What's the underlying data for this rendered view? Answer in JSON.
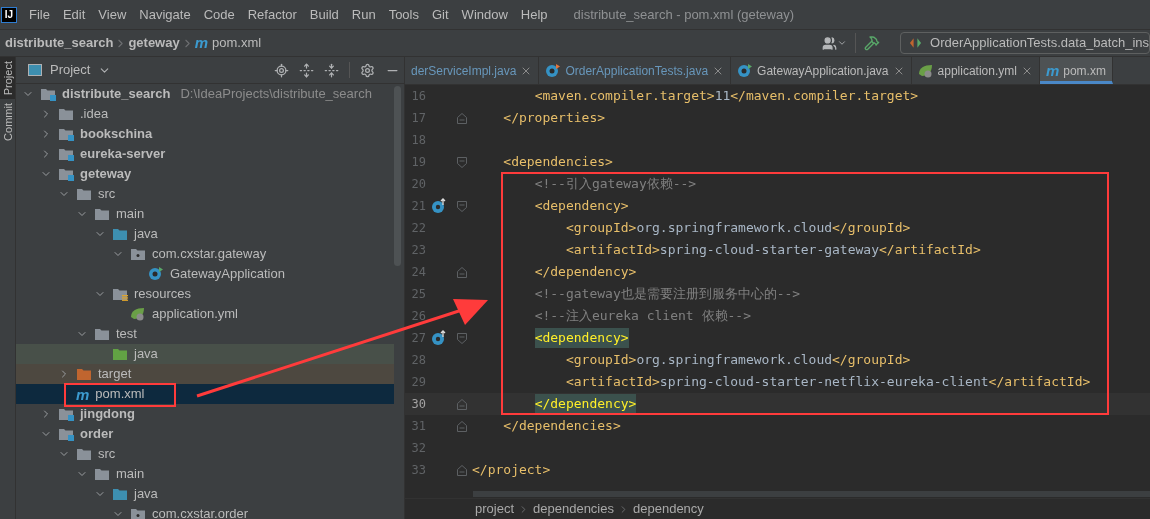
{
  "logo": "IJ",
  "menu": [
    "File",
    "Edit",
    "View",
    "Navigate",
    "Code",
    "Refactor",
    "Build",
    "Run",
    "Tools",
    "Git",
    "Window",
    "Help"
  ],
  "window_title": "distribute_search - pom.xml (geteway)",
  "navbar": {
    "crumbs": [
      {
        "label": "distribute_search"
      },
      {
        "label": "geteway"
      },
      {
        "label": "pom.xml",
        "badge": "m"
      }
    ],
    "run_config": "OrderApplicationTests.data_batch_ins"
  },
  "tool_strip": [
    {
      "label": "Project",
      "selected": true
    },
    {
      "label": "Commit",
      "selected": false
    }
  ],
  "project_panel": {
    "title": "Project",
    "tree": [
      {
        "label": "distribute_search",
        "kind": "module",
        "path": "D:\\IdeaProjects\\distribute_search",
        "expanded": true,
        "selected": false,
        "children": [
          {
            "label": ".idea",
            "kind": "folder",
            "expanded": false,
            "selected": false
          },
          {
            "label": "bookschina",
            "kind": "module",
            "expanded": false,
            "selected": false
          },
          {
            "label": "eureka-server",
            "kind": "module",
            "expanded": false,
            "selected": false
          },
          {
            "label": "geteway",
            "kind": "module",
            "expanded": true,
            "selected": false,
            "children": [
              {
                "label": "src",
                "kind": "folder",
                "expanded": true,
                "selected": false,
                "children": [
                  {
                    "label": "main",
                    "kind": "folder",
                    "expanded": true,
                    "selected": false,
                    "children": [
                      {
                        "label": "java",
                        "kind": "source",
                        "expanded": true,
                        "selected": false,
                        "children": [
                          {
                            "label": "com.cxstar.gateway",
                            "kind": "package",
                            "expanded": true,
                            "selected": false,
                            "children": [
                              {
                                "label": "GatewayApplication",
                                "kind": "class",
                                "selected": false
                              }
                            ]
                          }
                        ]
                      },
                      {
                        "label": "resources",
                        "kind": "resources",
                        "expanded": true,
                        "selected": false,
                        "children": [
                          {
                            "label": "application.yml",
                            "kind": "yml",
                            "selected": false
                          }
                        ]
                      }
                    ]
                  },
                  {
                    "label": "test",
                    "kind": "folder",
                    "expanded": true,
                    "selected": false,
                    "children": [
                      {
                        "label": "java",
                        "kind": "test",
                        "selected": false
                      }
                    ]
                  }
                ]
              },
              {
                "label": "target",
                "kind": "excluded",
                "expanded": false,
                "selected": false
              },
              {
                "label": "pom.xml",
                "kind": "maven",
                "badge": "m",
                "selected": true
              }
            ]
          },
          {
            "label": "jingdong",
            "kind": "module",
            "expanded": false,
            "selected": false
          },
          {
            "label": "order",
            "kind": "module",
            "expanded": true,
            "selected": false,
            "children": [
              {
                "label": "src",
                "kind": "folder",
                "expanded": true,
                "selected": false,
                "children": [
                  {
                    "label": "main",
                    "kind": "folder",
                    "expanded": true,
                    "selected": false,
                    "children": [
                      {
                        "label": "java",
                        "kind": "source",
                        "expanded": true,
                        "selected": false,
                        "children": [
                          {
                            "label": "com.cxstar.order",
                            "kind": "package",
                            "expanded": true,
                            "selected": false
                          }
                        ]
                      }
                    ]
                  }
                ]
              }
            ]
          }
        ]
      }
    ]
  },
  "editor": {
    "tabs": [
      {
        "label": "derServiceImpl.java",
        "kind": "cut",
        "modified": true,
        "selected": false
      },
      {
        "label": "OrderApplicationTests.java",
        "kind": "test-class",
        "modified": true,
        "selected": false
      },
      {
        "label": "GatewayApplication.java",
        "kind": "spring-class",
        "modified": false,
        "selected": false
      },
      {
        "label": "application.yml",
        "kind": "yml",
        "modified": false,
        "selected": false
      },
      {
        "label": "pom.xm",
        "kind": "maven",
        "badge": "m",
        "modified": false,
        "selected": true
      }
    ],
    "lines": [
      {
        "number": "16",
        "segments": [
          {
            "kind": "tag",
            "text": "        <maven.compiler.target>"
          },
          {
            "kind": "text",
            "text": "11"
          },
          {
            "kind": "tag",
            "text": "</maven.compiler.target>"
          }
        ]
      },
      {
        "number": "17",
        "fold_close": true,
        "segments": [
          {
            "kind": "tag",
            "text": "    </properties>"
          }
        ]
      },
      {
        "number": "18"
      },
      {
        "number": "19",
        "fold_open": true,
        "segments": [
          {
            "kind": "tag",
            "text": "    <dependencies>"
          }
        ]
      },
      {
        "number": "20",
        "segments": [
          {
            "kind": "comment",
            "text": "        <!--引入gateway依赖-->"
          }
        ]
      },
      {
        "number": "21",
        "fold_open": true,
        "gutter_icon": true,
        "segments": [
          {
            "kind": "tag",
            "text": "        <dependency>"
          }
        ]
      },
      {
        "number": "22",
        "segments": [
          {
            "kind": "tag",
            "text": "            <groupId>"
          },
          {
            "kind": "text",
            "text": "org.springframework.cloud"
          },
          {
            "kind": "tag",
            "text": "</groupId>"
          }
        ]
      },
      {
        "number": "23",
        "segments": [
          {
            "kind": "tag",
            "text": "            <artifactId>"
          },
          {
            "kind": "text",
            "text": "spring-cloud-starter-gateway"
          },
          {
            "kind": "tag",
            "text": "</artifactId>"
          }
        ]
      },
      {
        "number": "24",
        "fold_close": true,
        "segments": [
          {
            "kind": "tag",
            "text": "        </dependency>"
          }
        ]
      },
      {
        "number": "25",
        "segments": [
          {
            "kind": "comment",
            "text": "        <!--gateway也是需要注册到服务中心的-->"
          }
        ]
      },
      {
        "number": "26",
        "segments": [
          {
            "kind": "comment",
            "text": "        <!--注入eureka client 依赖-->"
          }
        ]
      },
      {
        "number": "27",
        "fold_open": true,
        "gutter_icon": true,
        "segments": [
          {
            "kind": "tag",
            "text": "        <dependency>",
            "matched": true
          }
        ]
      },
      {
        "number": "28",
        "segments": [
          {
            "kind": "tag",
            "text": "            <groupId>"
          },
          {
            "kind": "text",
            "text": "org.springframework.cloud"
          },
          {
            "kind": "tag",
            "text": "</groupId>"
          }
        ]
      },
      {
        "number": "29",
        "segments": [
          {
            "kind": "tag",
            "text": "            <artifactId>"
          },
          {
            "kind": "text",
            "text": "spring-cloud-starter-netflix-eureka-client"
          },
          {
            "kind": "tag",
            "text": "</artifactId>"
          }
        ]
      },
      {
        "number": "30",
        "fold_close": true,
        "current": true,
        "segments": [
          {
            "kind": "tag",
            "text": "        </dependency>",
            "matched": true
          }
        ]
      },
      {
        "number": "31",
        "fold_close": true,
        "segments": [
          {
            "kind": "tag",
            "text": "    </dependencies>"
          }
        ]
      },
      {
        "number": "32"
      },
      {
        "number": "33",
        "fold_close": true,
        "segments": [
          {
            "kind": "tag",
            "text": "</project>"
          }
        ]
      }
    ],
    "breadcrumbs": [
      "project",
      "dependencies",
      "dependency"
    ]
  }
}
